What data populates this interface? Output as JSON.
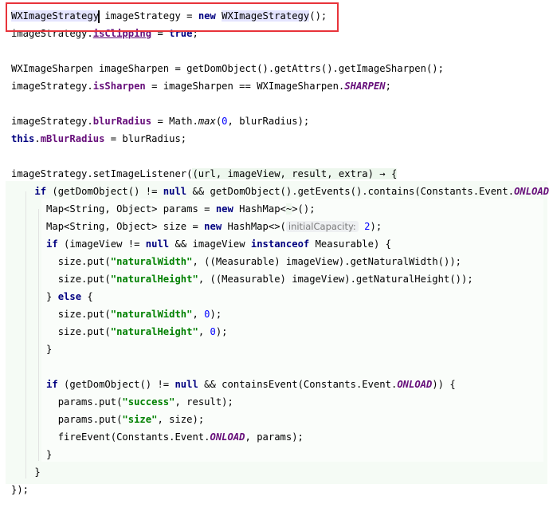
{
  "editor": {
    "language": "java",
    "highlight_box_color": "#e8333a",
    "lines": [
      {
        "tokens": [
          {
            "t": "WXImageStrategy",
            "c": "hl1"
          },
          {
            "t": "caret",
            "c": "caret"
          },
          {
            "t": " imageStrategy = ",
            "c": ""
          },
          {
            "t": "new",
            "c": "kw"
          },
          {
            "t": " ",
            "c": ""
          },
          {
            "t": "WXImageStrategy",
            "c": "hl1"
          },
          {
            "t": "();",
            "c": ""
          }
        ]
      },
      {
        "tokens": [
          {
            "t": "imageStrategy.",
            "c": ""
          },
          {
            "t": "isClipping",
            "c": "field u"
          },
          {
            "t": " = ",
            "c": ""
          },
          {
            "t": "true",
            "c": "kw"
          },
          {
            "t": ";",
            "c": ""
          }
        ]
      },
      {
        "tokens": []
      },
      {
        "tokens": [
          {
            "t": "WXImageSharpen imageSharpen = getDomObject().getAttrs().getImageSharpen();",
            "c": ""
          }
        ]
      },
      {
        "tokens": [
          {
            "t": "imageStrategy.",
            "c": ""
          },
          {
            "t": "isSharpen",
            "c": "field"
          },
          {
            "t": " = imageSharpen == WXImageSharpen.",
            "c": ""
          },
          {
            "t": "SHARPEN",
            "c": "staticf"
          },
          {
            "t": ";",
            "c": ""
          }
        ]
      },
      {
        "tokens": []
      },
      {
        "tokens": [
          {
            "t": "imageStrategy.",
            "c": ""
          },
          {
            "t": "blurRadius",
            "c": "field"
          },
          {
            "t": " = Math.",
            "c": ""
          },
          {
            "t": "max",
            "c": "staticm"
          },
          {
            "t": "(",
            "c": ""
          },
          {
            "t": "0",
            "c": "num"
          },
          {
            "t": ", blurRadius);",
            "c": ""
          }
        ]
      },
      {
        "tokens": [
          {
            "t": "this",
            "c": "kw"
          },
          {
            "t": ".",
            "c": ""
          },
          {
            "t": "mBlurRadius",
            "c": "field"
          },
          {
            "t": " = blurRadius;",
            "c": ""
          }
        ]
      },
      {
        "tokens": []
      },
      {
        "tokens": [
          {
            "t": "imageStrategy.setImageListener(",
            "c": ""
          },
          {
            "t": "(url, imageView, result, extra) ",
            "c": "hl2"
          },
          {
            "t": "→",
            "c": "hl2"
          },
          {
            "t": " {",
            "c": "hl2"
          }
        ]
      },
      {
        "tokens": [
          {
            "t": "    ",
            "c": ""
          },
          {
            "t": "if",
            "c": "kw"
          },
          {
            "t": " (getDomObject() != ",
            "c": ""
          },
          {
            "t": "null",
            "c": "kw"
          },
          {
            "t": " && getDomObject().getEvents().contains(Constants.Event.",
            "c": ""
          },
          {
            "t": "ONLOAD",
            "c": "staticf"
          },
          {
            "t": "))",
            "c": ""
          }
        ]
      },
      {
        "tokens": [
          {
            "t": "      Map<String, Object> params = ",
            "c": ""
          },
          {
            "t": "new",
            "c": "kw"
          },
          {
            "t": " HashMap<",
            "c": ""
          },
          {
            "t": "~",
            "c": "hl2"
          },
          {
            "t": ">();",
            "c": ""
          }
        ]
      },
      {
        "tokens": [
          {
            "t": "      Map<String, Object> size = ",
            "c": ""
          },
          {
            "t": "new",
            "c": "kw"
          },
          {
            "t": " HashMap<>(",
            "c": ""
          },
          {
            "t": "initialCapacity:",
            "c": "hint"
          },
          {
            "t": " ",
            "c": ""
          },
          {
            "t": "2",
            "c": "num"
          },
          {
            "t": ");",
            "c": ""
          }
        ]
      },
      {
        "tokens": [
          {
            "t": "      ",
            "c": ""
          },
          {
            "t": "if",
            "c": "kw"
          },
          {
            "t": " (imageView != ",
            "c": ""
          },
          {
            "t": "null",
            "c": "kw"
          },
          {
            "t": " && imageView ",
            "c": ""
          },
          {
            "t": "instanceof",
            "c": "kw"
          },
          {
            "t": " Measurable) {",
            "c": ""
          }
        ]
      },
      {
        "tokens": [
          {
            "t": "        size.put(",
            "c": ""
          },
          {
            "t": "\"naturalWidth\"",
            "c": "str"
          },
          {
            "t": ", ((Measurable) imageView).getNaturalWidth());",
            "c": ""
          }
        ]
      },
      {
        "tokens": [
          {
            "t": "        size.put(",
            "c": ""
          },
          {
            "t": "\"naturalHeight\"",
            "c": "str"
          },
          {
            "t": ", ((Measurable) imageView).getNaturalHeight());",
            "c": ""
          }
        ]
      },
      {
        "tokens": [
          {
            "t": "      } ",
            "c": ""
          },
          {
            "t": "else",
            "c": "kw"
          },
          {
            "t": " {",
            "c": ""
          }
        ]
      },
      {
        "tokens": [
          {
            "t": "        size.put(",
            "c": ""
          },
          {
            "t": "\"naturalWidth\"",
            "c": "str"
          },
          {
            "t": ", ",
            "c": ""
          },
          {
            "t": "0",
            "c": "num"
          },
          {
            "t": ");",
            "c": ""
          }
        ]
      },
      {
        "tokens": [
          {
            "t": "        size.put(",
            "c": ""
          },
          {
            "t": "\"naturalHeight\"",
            "c": "str"
          },
          {
            "t": ", ",
            "c": ""
          },
          {
            "t": "0",
            "c": "num"
          },
          {
            "t": ");",
            "c": ""
          }
        ]
      },
      {
        "tokens": [
          {
            "t": "      }",
            "c": ""
          }
        ]
      },
      {
        "tokens": []
      },
      {
        "tokens": [
          {
            "t": "      ",
            "c": ""
          },
          {
            "t": "if",
            "c": "kw"
          },
          {
            "t": " (getDomObject() != ",
            "c": ""
          },
          {
            "t": "null",
            "c": "kw"
          },
          {
            "t": " && containsEvent(Constants.Event.",
            "c": ""
          },
          {
            "t": "ONLOAD",
            "c": "staticf"
          },
          {
            "t": ")) {",
            "c": ""
          }
        ]
      },
      {
        "tokens": [
          {
            "t": "        params.put(",
            "c": ""
          },
          {
            "t": "\"success\"",
            "c": "str"
          },
          {
            "t": ", result);",
            "c": ""
          }
        ]
      },
      {
        "tokens": [
          {
            "t": "        params.put(",
            "c": ""
          },
          {
            "t": "\"size\"",
            "c": "str"
          },
          {
            "t": ", size);",
            "c": ""
          }
        ]
      },
      {
        "tokens": [
          {
            "t": "        fireEvent(Constants.Event.",
            "c": ""
          },
          {
            "t": "ONLOAD",
            "c": "staticf"
          },
          {
            "t": ", params);",
            "c": ""
          }
        ]
      },
      {
        "tokens": [
          {
            "t": "      }",
            "c": ""
          }
        ]
      },
      {
        "tokens": [
          {
            "t": "    }",
            "c": ""
          }
        ]
      },
      {
        "tokens": [
          {
            "t": "});",
            "c": ""
          }
        ]
      }
    ]
  }
}
